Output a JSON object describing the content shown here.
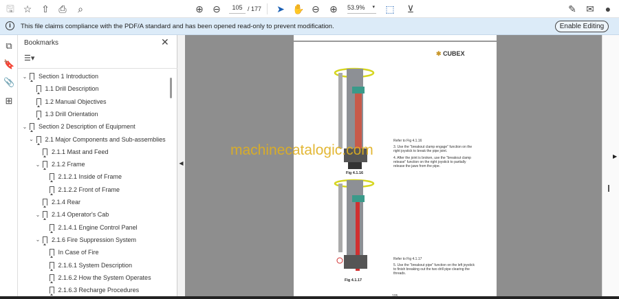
{
  "toolbar": {
    "page_current": "105",
    "page_total": "/ 177",
    "zoom": "53.9%"
  },
  "infobar": {
    "message": "This file claims compliance with the PDF/A standard and has been opened read-only to prevent modification.",
    "enable_editing": "Enable Editing"
  },
  "bookmarks": {
    "title": "Bookmarks",
    "items": [
      {
        "label": "Section 1 Introduction",
        "level": 0,
        "expanded": true
      },
      {
        "label": "1.1 Drill Description",
        "level": 1
      },
      {
        "label": "1.2 Manual Objectives",
        "level": 1
      },
      {
        "label": "1.3 Drill Orientation",
        "level": 1
      },
      {
        "label": "Section 2 Description of Equipment",
        "level": 0,
        "expanded": true
      },
      {
        "label": "2.1 Major Components and Sub-assemblies",
        "level": 1,
        "expanded": true
      },
      {
        "label": "2.1.1 Mast and Feed",
        "level": 2
      },
      {
        "label": "2.1.2 Frame",
        "level": 2,
        "expanded": true
      },
      {
        "label": "2.1.2.1 Inside of Frame",
        "level": 3
      },
      {
        "label": "2.1.2.2 Front of Frame",
        "level": 3
      },
      {
        "label": "2.1.4 Rear",
        "level": 2
      },
      {
        "label": "2.1.4 Operator's Cab",
        "level": 2,
        "expanded": true
      },
      {
        "label": "2.1.4.1 Engine Control Panel",
        "level": 3
      },
      {
        "label": "2.1.6 Fire Suppression System",
        "level": 2,
        "expanded": true
      },
      {
        "label": "In Case of Fire",
        "level": 3
      },
      {
        "label": "2.1.6.1 System Description",
        "level": 3
      },
      {
        "label": "2.1.6.2 How the System Operates",
        "level": 3
      },
      {
        "label": "2.1.6.3 Recharge Procedures",
        "level": 3
      }
    ]
  },
  "document": {
    "logo": "CUBEX",
    "fig1": {
      "caption": "Fig 4.1.16",
      "refer": "Refer to Fig 4.1.16",
      "steps": [
        "3. Use the \"breakout clamp engage\" function on the right joystick to break the pipe joint.",
        "4. After the joint is broken, use the \"breakout clamp release\" function on the right joystick to partially release the jaws from the pipe."
      ]
    },
    "fig2": {
      "caption": "Fig 4.1.17",
      "refer": "Refer to Fig 4.1.17",
      "steps": [
        "5. Use the \"breakout pipe\" function on the left joystick to finish breaking out the two drill pipe clearing the threads."
      ]
    },
    "page_number": "105",
    "watermark": "machinecatalogic.com"
  }
}
